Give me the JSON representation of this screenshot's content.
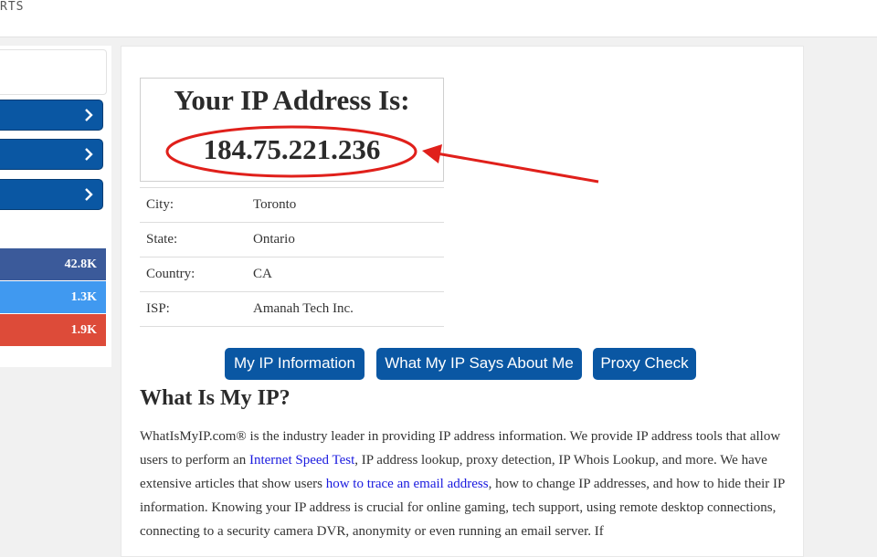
{
  "topbar": {
    "nav_fragment": "RTS"
  },
  "sidebar": {
    "share_counts": [
      {
        "value": "42.8K",
        "color": "#3b5a9a"
      },
      {
        "value": "1.3K",
        "color": "#4099f0"
      },
      {
        "value": "1.9K",
        "color": "#dd4b39"
      }
    ]
  },
  "ipbox": {
    "heading": "Your IP Address Is:",
    "ip": "184.75.221.236"
  },
  "info": {
    "rows": [
      {
        "label": "City:",
        "value": "Toronto"
      },
      {
        "label": "State:",
        "value": "Ontario"
      },
      {
        "label": "Country:",
        "value": "CA"
      },
      {
        "label": "ISP:",
        "value": "Amanah Tech Inc."
      }
    ]
  },
  "buttons": {
    "my_ip_info": "My IP Information",
    "what_my_ip_says": "What My IP Says About Me",
    "proxy_check": "Proxy Check"
  },
  "article": {
    "title": "What Is My IP?",
    "p1": "WhatIsMyIP.com® is the industry leader in providing IP address information. We provide IP address tools that allow users to perform an ",
    "link1": "Internet Speed Test",
    "p2": ", IP address lookup, proxy detection, IP Whois Lookup, and more. We have extensive articles that show users ",
    "link2": "how to trace an email address",
    "p3": ", how to change IP addresses, and how to hide their IP information. Knowing your IP address is crucial for online gaming, tech support, using remote desktop connections, connecting to a security camera DVR, anonymity or even running an email server. If"
  },
  "colors": {
    "button_blue": "#0a57a3",
    "annotation_red": "#e0201b",
    "link_blue": "#1a1adf"
  }
}
